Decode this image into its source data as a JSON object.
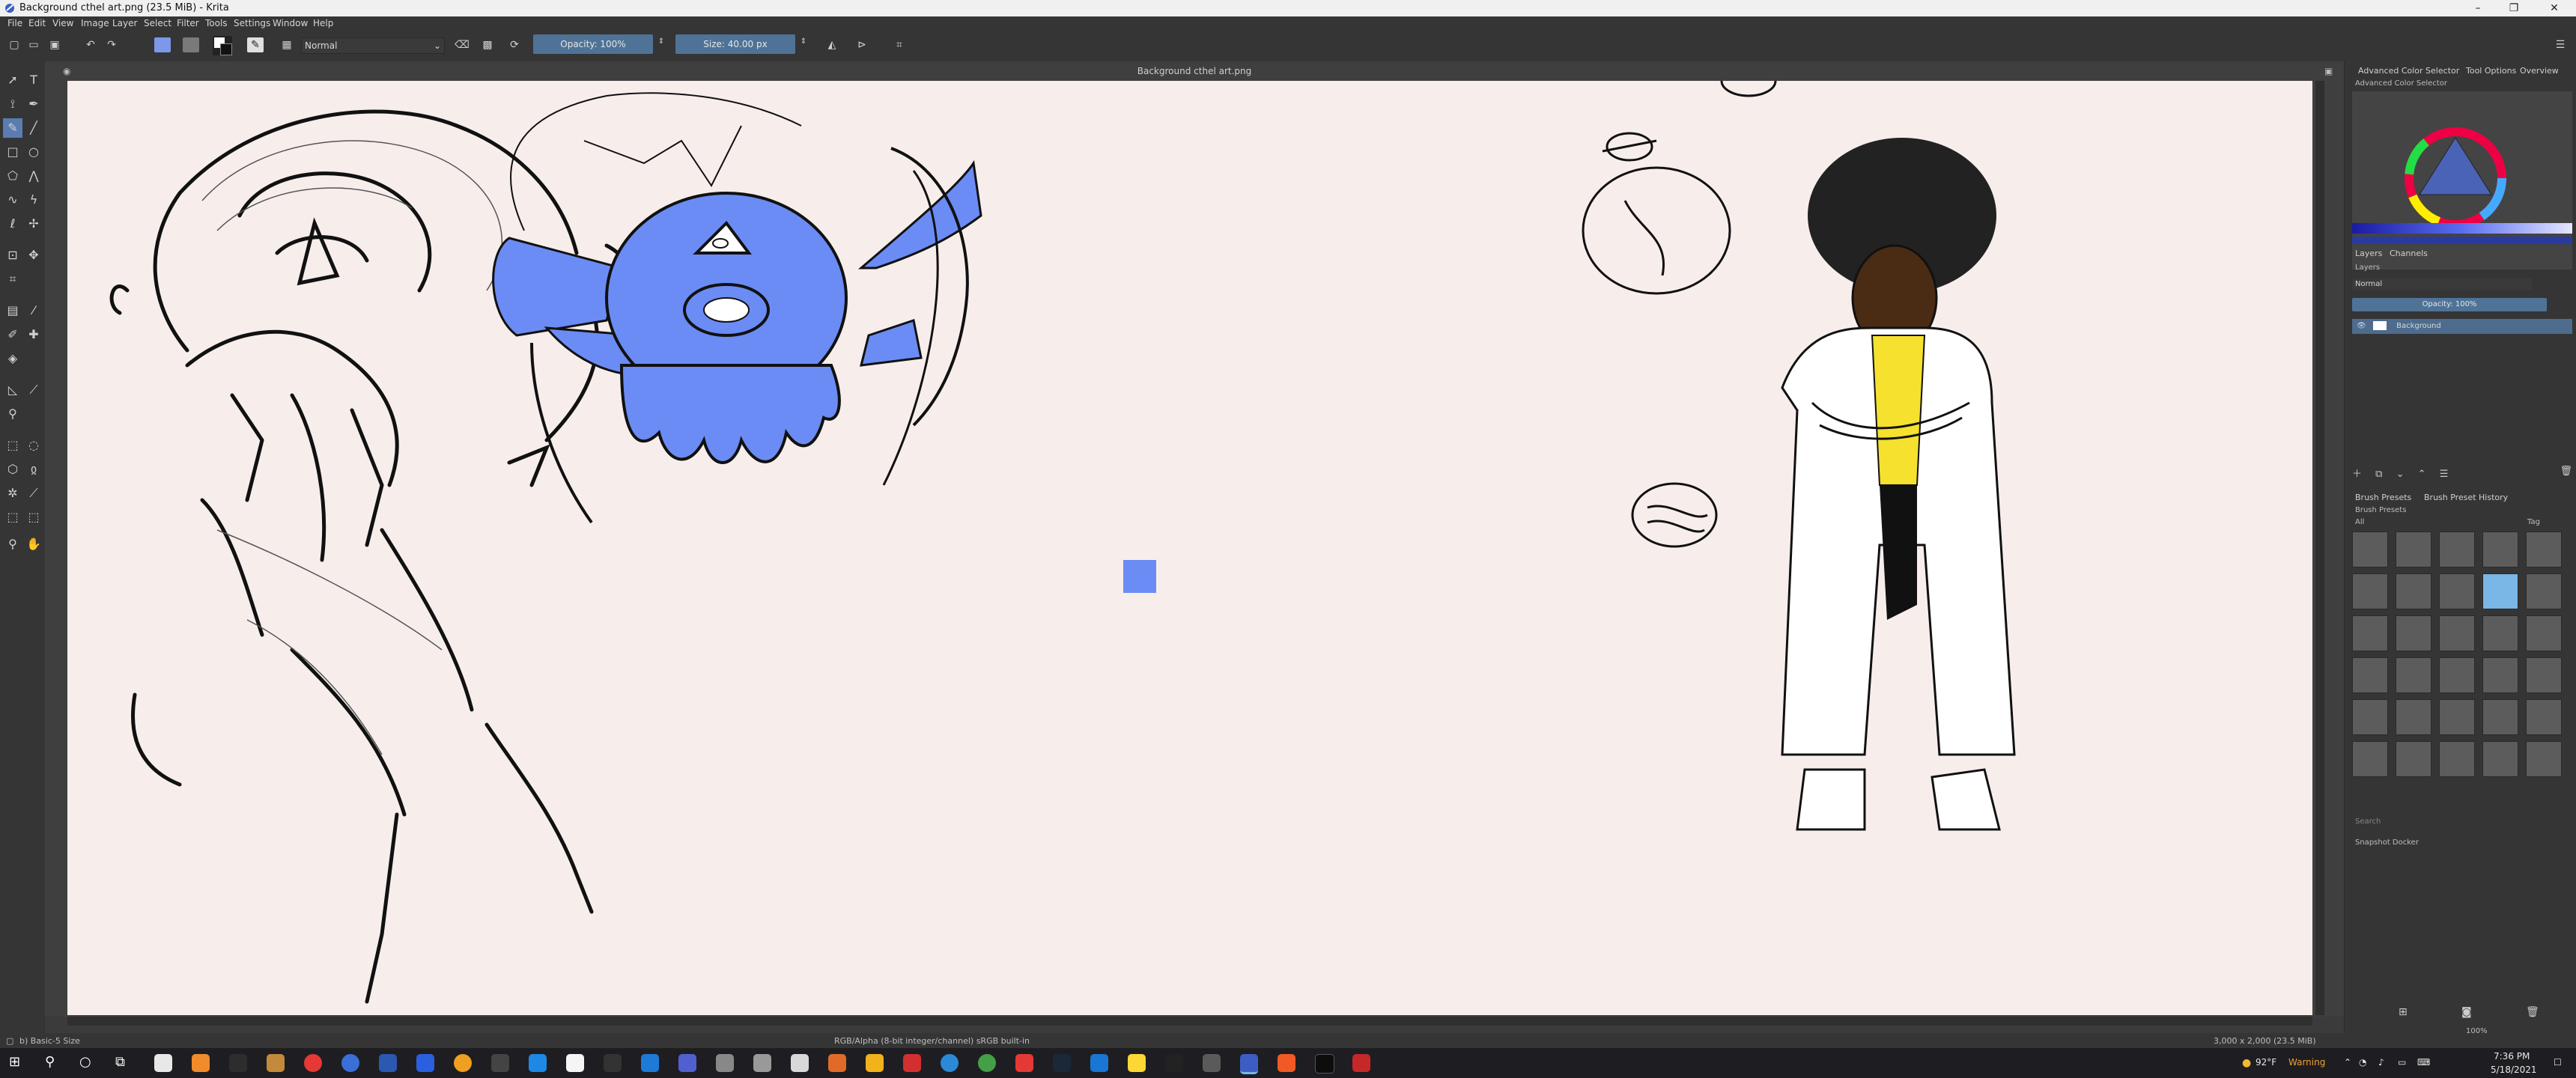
{
  "window": {
    "title": "Background cthel art.png (23.5 MiB)  - Krita",
    "controls": {
      "minimize": "–",
      "maximize": "❐",
      "close": "✕"
    }
  },
  "menu": [
    "File",
    "Edit",
    "View",
    "Image",
    "Layer",
    "Select",
    "Filter",
    "Tools",
    "Settings",
    "Window",
    "Help"
  ],
  "tool_options": {
    "blend_mode": "Normal",
    "opacity": "Opacity: 100%",
    "size": "Size: 40.00 px",
    "fg_color": "#6f8cf2",
    "bg_color": "#8a8a8a"
  },
  "canvas": {
    "document_title": "Background cthel art.png",
    "background": "#f7eeec",
    "swatch_color": "#6b8cf5"
  },
  "dockers": {
    "color_tabs": [
      "Advanced Color Selector",
      "Tool Options",
      "Overview"
    ],
    "color_panel_title": "Advanced Color Selector",
    "layer_tabs": [
      "Layers",
      "Channels"
    ],
    "layers_label": "Layers",
    "layer_blend": "Normal",
    "layer_opacity": "Opacity: 100%",
    "layer_name": "Background",
    "brush_tabs": [
      "Brush Presets",
      "Brush Preset History"
    ],
    "brush_presets_label": "Brush Presets",
    "brush_filter": "All",
    "brush_tag": "Tag",
    "search_placeholder": "Search",
    "snapshot_title": "Snapshot Docker",
    "zoom": "100%"
  },
  "status": {
    "brush": "b) Basic-5 Size",
    "colorspace": "RGB/Alpha (8-bit integer/channel)  sRGB built-in",
    "dimensions": "3,000 x 2,000 (23.5 MiB)"
  },
  "taskbar": {
    "weather": "92°F",
    "warning": "Warning",
    "time": "7:36 PM",
    "date": "5/18/2021"
  }
}
